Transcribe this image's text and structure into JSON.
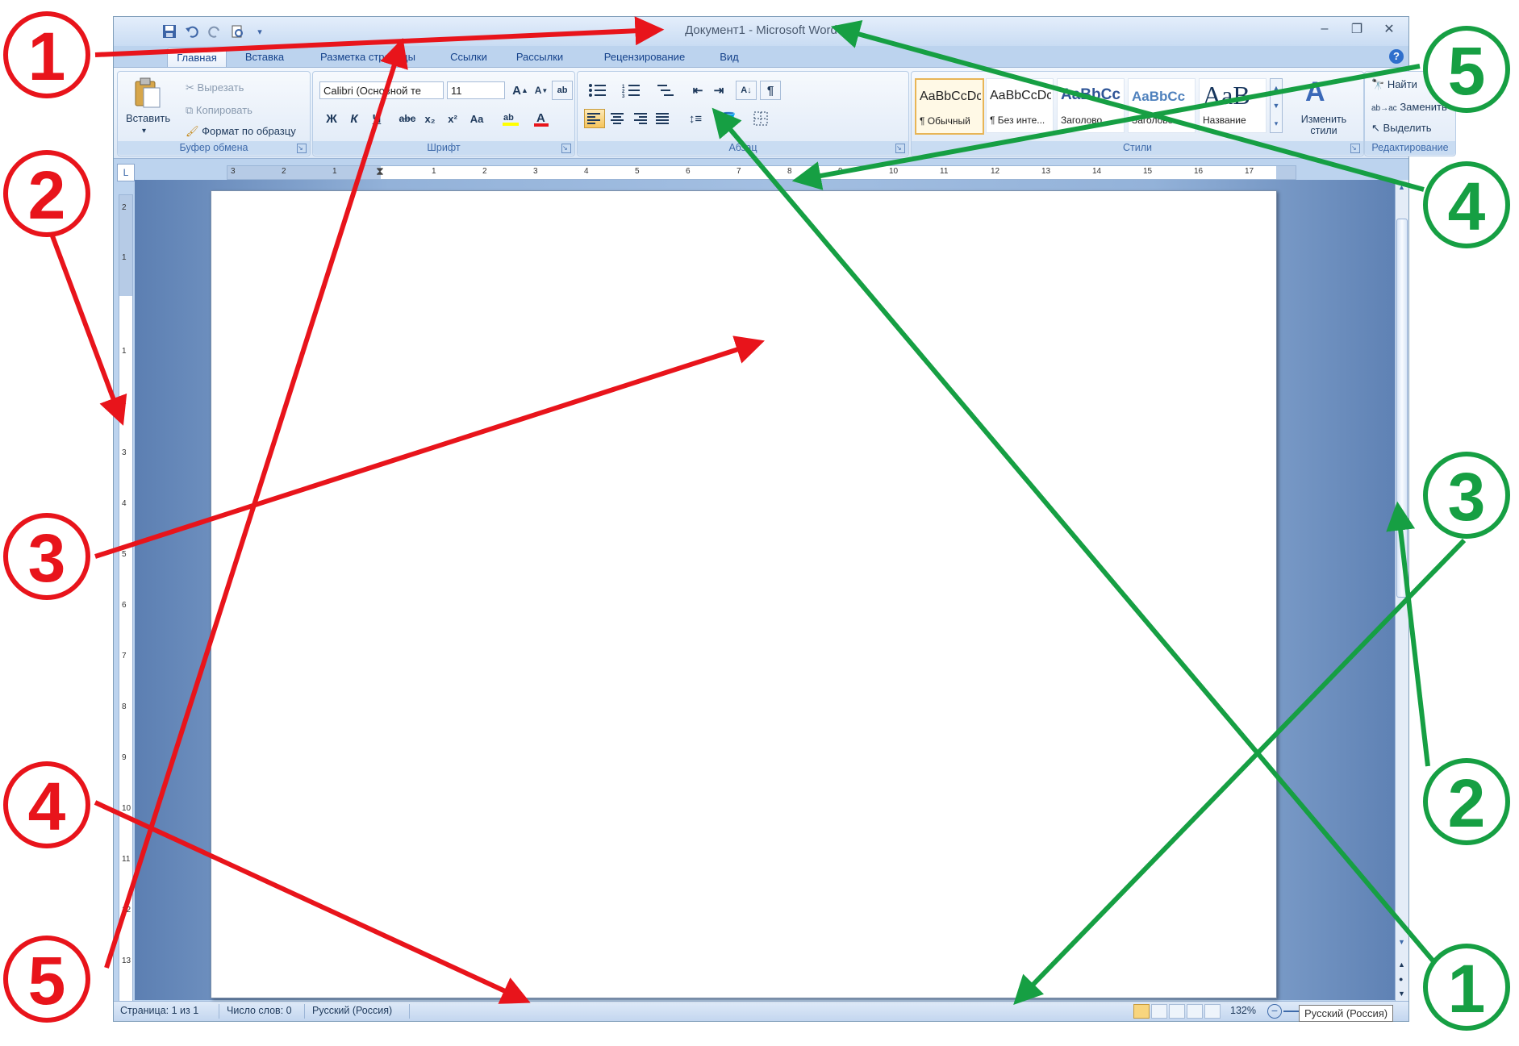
{
  "window": {
    "title": "Документ1 - Microsoft Word",
    "controls": [
      "–",
      "❐",
      "✕"
    ]
  },
  "tabs": [
    "Главная",
    "Вставка",
    "Разметка страницы",
    "Ссылки",
    "Рассылки",
    "Рецензирование",
    "Вид"
  ],
  "ribbon": {
    "clipboard": {
      "paste": "Вставить",
      "cut": "Вырезать",
      "copy": "Копировать",
      "format_painter": "Формат по образцу",
      "label": "Буфер обмена"
    },
    "font": {
      "font_name": "Calibri (Основной те",
      "font_size": "11",
      "label": "Шрифт",
      "buttons": [
        "Ж",
        "К",
        "Ч",
        "abc",
        "x₂",
        "x²",
        "Aa"
      ]
    },
    "paragraph": {
      "label": "Абзац"
    },
    "styles": {
      "items": [
        {
          "preview": "AaBbCcDc",
          "name": "¶ Обычный"
        },
        {
          "preview": "AaBbCcDc",
          "name": "¶ Без инте..."
        },
        {
          "preview": "AaBbCc",
          "name": "Заголово..."
        },
        {
          "preview": "AaBbCc",
          "name": "Заголово..."
        },
        {
          "preview": "AaB",
          "name": "Название"
        }
      ],
      "change_styles": "Изменить стили",
      "label": "Стили"
    },
    "editing": {
      "find": "Найти",
      "replace": "Заменить",
      "select": "Выделить",
      "label": "Редактирование"
    }
  },
  "ruler": {
    "h_numbers": [
      "3",
      "2",
      "1",
      "1",
      "2",
      "3",
      "4",
      "5",
      "6",
      "7",
      "8",
      "9",
      "10",
      "11",
      "12",
      "13",
      "14",
      "15",
      "16",
      "17"
    ],
    "v_numbers": [
      "2",
      "1",
      "1",
      "2",
      "3",
      "4",
      "5",
      "6",
      "7",
      "8",
      "9",
      "10",
      "11",
      "12",
      "13"
    ]
  },
  "status": {
    "page": "Страница: 1 из 1",
    "words": "Число слов: 0",
    "language": "Русский (Россия)",
    "zoom": "132%",
    "tooltip": "Русский (Россия)"
  },
  "callouts": {
    "red": [
      "1",
      "2",
      "3",
      "4",
      "5"
    ],
    "green": [
      "5",
      "4",
      "3",
      "2",
      "1"
    ]
  },
  "colors": {
    "red": "#e8141b",
    "green": "#169f43"
  }
}
